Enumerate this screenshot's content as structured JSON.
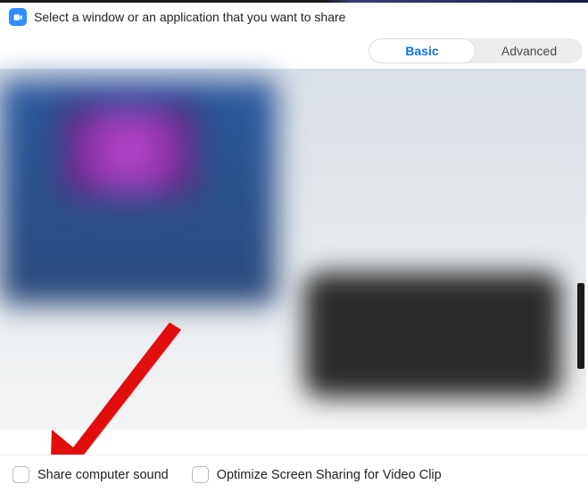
{
  "header": {
    "title": "Select a window or an application that you want to share"
  },
  "tabs": {
    "basic": "Basic",
    "advanced": "Advanced"
  },
  "footer": {
    "share_sound": "Share computer sound",
    "optimize": "Optimize Screen Sharing for Video Clip"
  }
}
